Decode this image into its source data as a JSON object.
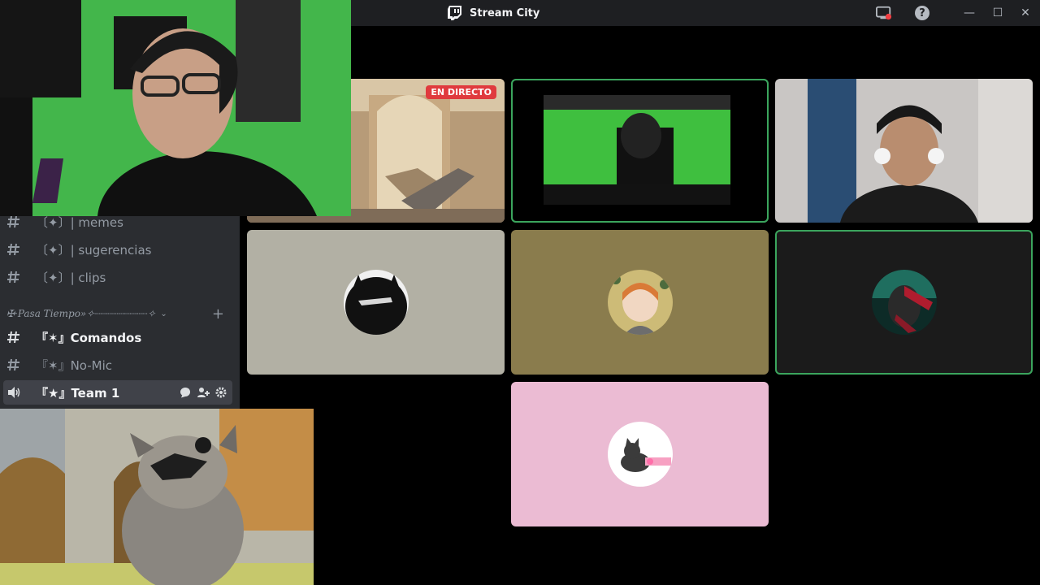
{
  "window": {
    "title": "Stream City"
  },
  "titlebar": {
    "icons": [
      "screen-share-icon",
      "help-icon",
      "minimize-icon",
      "maximize-icon",
      "close-icon"
    ],
    "help_glyph": "?",
    "min_glyph": "—",
    "max_glyph": "☐",
    "close_glyph": "✕"
  },
  "sidebar": {
    "channels": [
      {
        "label": "〔✦〕| memes"
      },
      {
        "label": "〔✦〕| sugerencias"
      },
      {
        "label": "〔✦〕| clips"
      }
    ],
    "category": {
      "label": "✠·Pasa Tiempo»✧┈┈┈┈┈┈┈┈┈✧",
      "chevron": "⌄",
      "plus": "+"
    },
    "channels2": [
      {
        "label": "『✶』Comandos"
      },
      {
        "label": "『✶』No-Mic"
      }
    ],
    "voice_channel": {
      "label": "『★』Team 1"
    }
  },
  "stage": {
    "live_badge": "EN DIRECTO"
  },
  "colors": {
    "accent_speaking": "#3ba55d",
    "live_red": "#e03a3e",
    "tile_gray": "#b2b0a4",
    "tile_olive": "#8a7c4d",
    "tile_dark": "#1b1b1b",
    "tile_pink": "#ebbbd3"
  }
}
